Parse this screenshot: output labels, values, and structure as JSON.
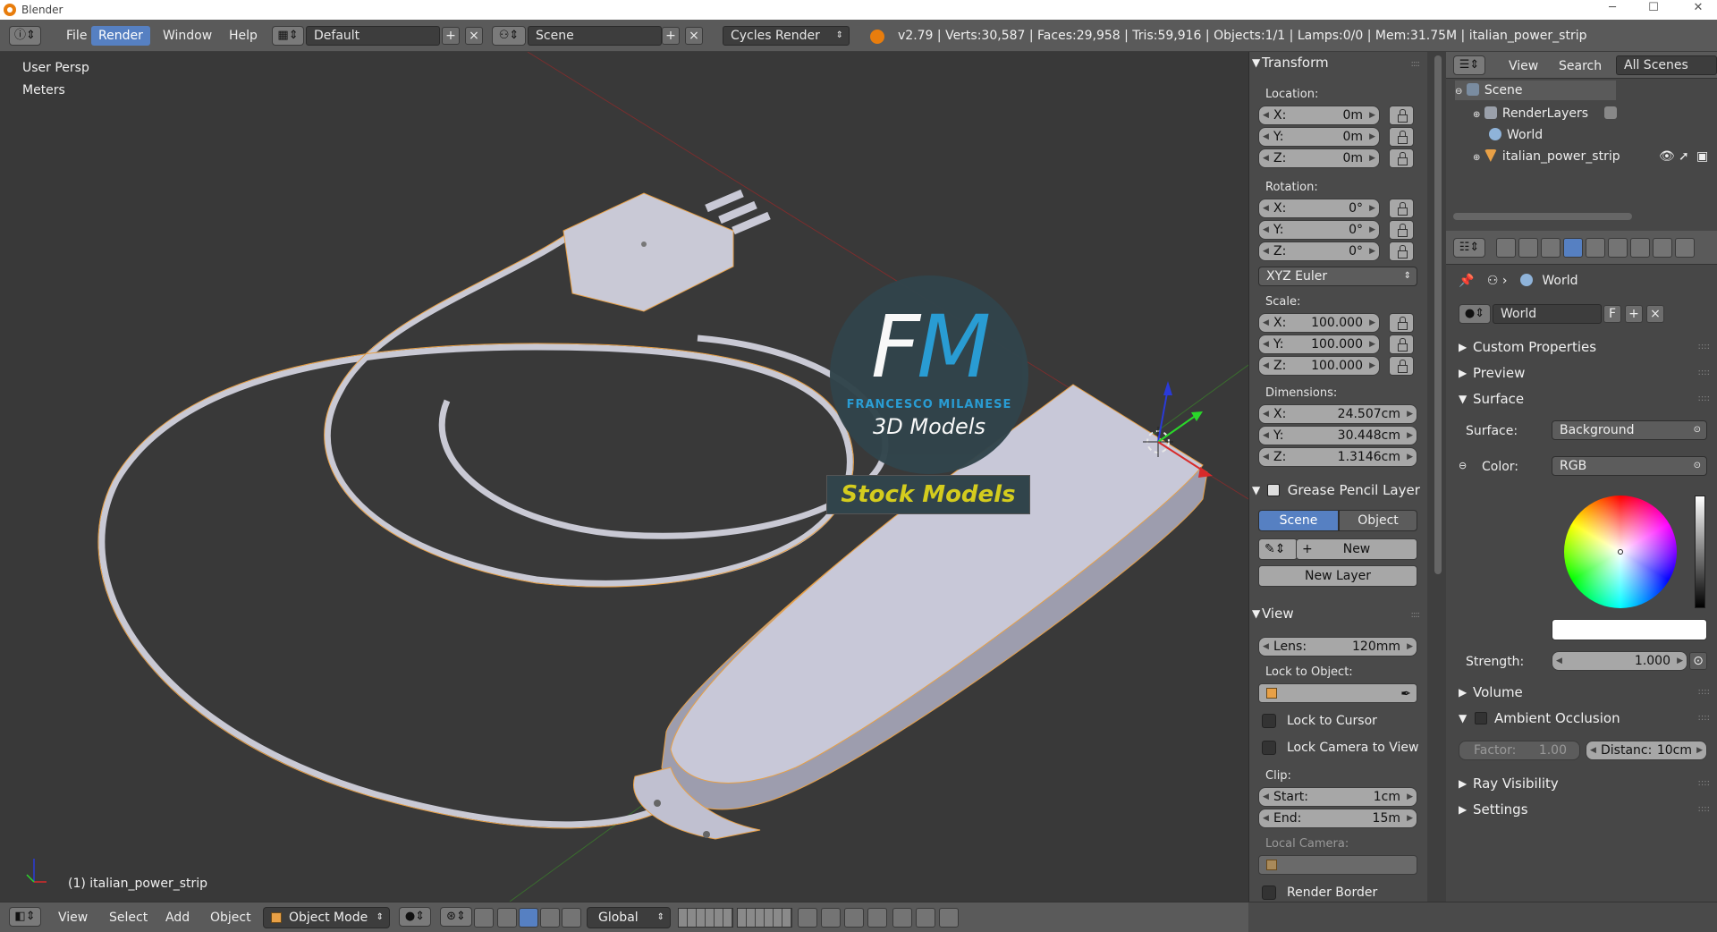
{
  "window": {
    "title": "Blender",
    "minimize": "─",
    "maximize": "☐",
    "close": "✕"
  },
  "info": {
    "menus": [
      "File",
      "Render",
      "Window",
      "Help"
    ],
    "layout": "Default",
    "scene": "Scene",
    "engine": "Cycles Render",
    "stats": "v2.79 | Verts:30,587 | Faces:29,958 | Tris:59,916 | Objects:1/1 | Lamps:0/0 | Mem:31.75M | italian_power_strip"
  },
  "viewport": {
    "view_label": "User Persp",
    "units_label": "Meters",
    "object_label": "(1) italian_power_strip",
    "watermark": {
      "fm_f": "F",
      "fm_m": "M",
      "maker": "FRANCESCO MILANESE",
      "sub": "3D Models",
      "badge": "Stock Models"
    }
  },
  "transform": {
    "header": "Transform",
    "location_label": "Location:",
    "location": [
      {
        "k": "X:",
        "v": "0m"
      },
      {
        "k": "Y:",
        "v": "0m"
      },
      {
        "k": "Z:",
        "v": "0m"
      }
    ],
    "rotation_label": "Rotation:",
    "rotation": [
      {
        "k": "X:",
        "v": "0°"
      },
      {
        "k": "Y:",
        "v": "0°"
      },
      {
        "k": "Z:",
        "v": "0°"
      }
    ],
    "rotation_mode": "XYZ Euler",
    "scale_label": "Scale:",
    "scale": [
      {
        "k": "X:",
        "v": "100.000"
      },
      {
        "k": "Y:",
        "v": "100.000"
      },
      {
        "k": "Z:",
        "v": "100.000"
      }
    ],
    "dimensions_label": "Dimensions:",
    "dimensions": [
      {
        "k": "X:",
        "v": "24.507cm"
      },
      {
        "k": "Y:",
        "v": "30.448cm"
      },
      {
        "k": "Z:",
        "v": "1.3146cm"
      }
    ]
  },
  "grease": {
    "header": "Grease Pencil Layer",
    "scene_btn": "Scene",
    "object_btn": "Object",
    "new_btn": "New",
    "new_layer_btn": "New Layer"
  },
  "view": {
    "header": "View",
    "lens_k": "Lens:",
    "lens_v": "120mm",
    "lock_to_object": "Lock to Object:",
    "lock_to_cursor": "Lock to Cursor",
    "lock_camera": "Lock Camera to View",
    "clip_label": "Clip:",
    "start_k": "Start:",
    "start_v": "1cm",
    "end_k": "End:",
    "end_v": "15m",
    "local_camera": "Local Camera:",
    "render_border": "Render Border"
  },
  "outliner": {
    "view": "View",
    "search": "Search",
    "filter": "All Scenes",
    "items": [
      "Scene",
      "RenderLayers",
      "World",
      "italian_power_strip"
    ]
  },
  "properties": {
    "crumb": "World",
    "world_name": "World",
    "fake_user": "F",
    "sections": {
      "custom": "Custom Properties",
      "preview": "Preview",
      "surface": "Surface",
      "volume": "Volume",
      "ao": "Ambient Occlusion",
      "ray": "Ray Visibility",
      "settings": "Settings"
    },
    "surface_label": "Surface:",
    "surface_value": "Background",
    "color_label": "Color:",
    "color_mode": "RGB",
    "strength_label": "Strength:",
    "strength_value": "1.000",
    "factor_label": "Factor:",
    "factor_value": "1.00",
    "distance_label": "Distanc:",
    "distance_value": "10cm"
  },
  "bottom": {
    "menus": [
      "View",
      "Select",
      "Add",
      "Object"
    ],
    "mode": "Object Mode",
    "orientation": "Global"
  },
  "colors": {
    "accent": "#5680c2",
    "viewport_bg": "#393939",
    "panel_bg": "#4a4a4a",
    "object_outline": "#e8a046"
  }
}
